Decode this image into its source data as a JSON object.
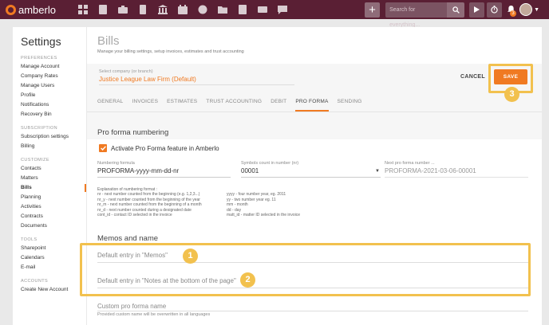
{
  "app": {
    "logo_text": "amberlo",
    "search_placeholder": "Search for everything...",
    "notification_count": "3",
    "nav_icons": [
      "dashboard-icon",
      "contacts-icon",
      "briefcase-icon",
      "bills-icon",
      "bank-icon",
      "calendar-icon",
      "timer-history-icon",
      "folder-icon",
      "documents-icon",
      "mail-icon",
      "chat-icon"
    ]
  },
  "sidebar": {
    "title": "Settings",
    "sections": [
      {
        "label": "PREFERENCES",
        "items": [
          "Manage Account",
          "Company Rates",
          "Manage Users",
          "Profile",
          "Notifications",
          "Recovery Bin"
        ]
      },
      {
        "label": "SUBSCRIPTION",
        "items": [
          "Subscription settings",
          "Billing"
        ]
      },
      {
        "label": "CUSTOMIZE",
        "items": [
          "Contacts",
          "Matters",
          "Bills",
          "Planning",
          "Activities",
          "Contracts",
          "Documents"
        ]
      },
      {
        "label": "TOOLS",
        "items": [
          "Sharepoint",
          "Calendars",
          "E-mail"
        ]
      },
      {
        "label": "ACCOUNTS",
        "items": [
          "Create New Account"
        ]
      }
    ],
    "active_item": "Bills"
  },
  "page": {
    "title": "Bills",
    "subtitle": "Manage your billing settings, setup invoices, estimates and trust accounting",
    "company_label": "Select company (or branch)",
    "company_value": "Justice League Law Firm (Default)",
    "cancel_label": "CANCEL",
    "save_label": "SAVE",
    "tabs": [
      "GENERAL",
      "INVOICES",
      "ESTIMATES",
      "TRUST ACCOUNTING",
      "DEBIT",
      "PRO FORMA",
      "SENDING"
    ],
    "active_tab": "PRO FORMA"
  },
  "proforma": {
    "section_title": "Pro forma numbering",
    "activate_label": "Activate Pro Forma feature in Amberlo",
    "activate_checked": true,
    "formula_label": "Numbering formula",
    "formula_value": "PROFORMA-yyyy-mm-dd-nr",
    "symbols_label": "Symbols count in number (nr)",
    "symbols_value": "00001",
    "next_label": "Next pro forma number ...",
    "next_value": "PROFORMA-2021-03-06-00001",
    "explanation_title": "Explanation of numbering format :",
    "explanation_left": [
      "nr - next number counted from the beginning (e.g. 1,2,3...)",
      "nr_y - next number counted from the beginning of the year",
      "nr_m - next number counted from the beginning of a month",
      "nr_d - next number counted during a designated date",
      "cont_id - contact ID selected in the invoice"
    ],
    "explanation_right": [
      "yyyy - four number year, eg. 2011",
      "yy - two number year eg. 11",
      "mm - month",
      "dd - day",
      "matt_id - matter ID selected in the invoice"
    ]
  },
  "memos": {
    "section_title": "Memos and name",
    "memos_placeholder": "Default entry in \"Memos\"",
    "notes_placeholder": "Default entry in \"Notes at the bottom of the page\"",
    "custom_placeholder": "Custom pro forma name",
    "custom_hint": "Provided custom name will be overwritten in all languages"
  },
  "annotations": {
    "callout_1": "1",
    "callout_2": "2",
    "callout_3": "3",
    "highlight_color": "#f2c14e"
  },
  "colors": {
    "topbar": "#5a1f34",
    "accent": "#f07a22"
  }
}
